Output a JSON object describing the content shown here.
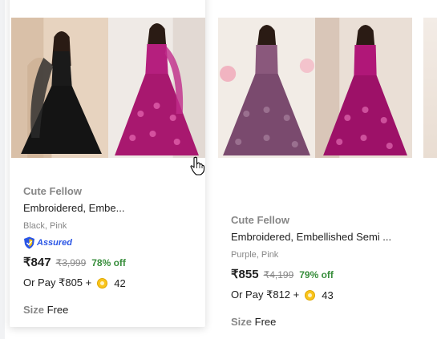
{
  "products": [
    {
      "brand": "Cute Fellow",
      "title": "Embroidered, Embe...",
      "colors": "Black, Pink",
      "assured": "Assured",
      "price": "₹847",
      "mrp": "₹3,999",
      "discount": "78% off",
      "pay_prefix": "Or Pay ₹805 +",
      "coins": "42",
      "size_label": "Size",
      "size_value": "Free",
      "image_colors": [
        "#1c1c1c",
        "#b51f7e"
      ]
    },
    {
      "brand": "Cute Fellow",
      "title": "Embroidered, Embellished Semi ...",
      "colors": "Purple, Pink",
      "price": "₹855",
      "mrp": "₹4,199",
      "discount": "79% off",
      "pay_prefix": "Or Pay ₹812 +",
      "coins": "43",
      "size_label": "Size",
      "size_value": "Free",
      "image_colors": [
        "#7a4a6e",
        "#b01778"
      ]
    }
  ],
  "icons": {
    "assured": "flipkart-assured-shield-icon",
    "coin": "supercoin-icon",
    "cursor": "hand-pointer-cursor-icon"
  }
}
